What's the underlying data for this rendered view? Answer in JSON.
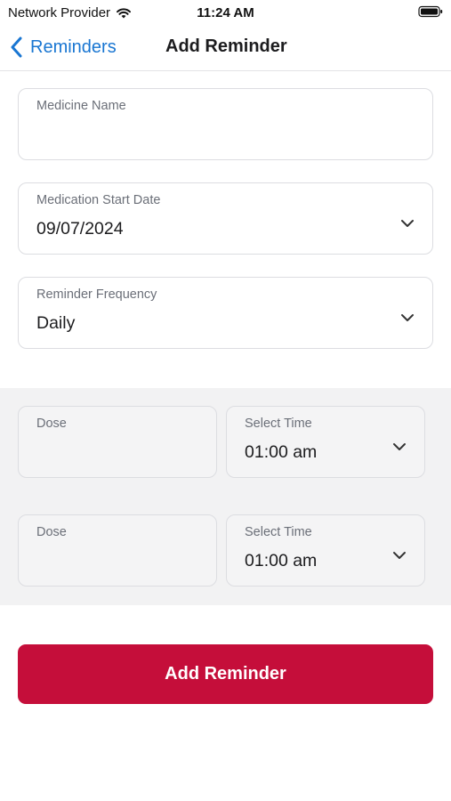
{
  "status_bar": {
    "carrier": "Network Provider",
    "time": "11:24 AM",
    "wifi_icon": "wifi-icon",
    "battery_icon": "battery-icon"
  },
  "nav": {
    "back_label": "Reminders",
    "back_icon": "chevron-left-icon",
    "title": "Add Reminder"
  },
  "form": {
    "medicine_name": {
      "label": "Medicine Name",
      "value": ""
    },
    "start_date": {
      "label": "Medication Start Date",
      "value": "09/07/2024"
    },
    "frequency": {
      "label": "Reminder Frequency",
      "value": "Daily"
    }
  },
  "doses": [
    {
      "dose_label": "Dose",
      "dose_value": "",
      "time_label": "Select Time",
      "time_value": "01:00 am"
    },
    {
      "dose_label": "Dose",
      "dose_value": "",
      "time_label": "Select Time",
      "time_value": "01:00 am"
    }
  ],
  "submit_label": "Add Reminder",
  "colors": {
    "accent": "#1976d2",
    "primary_button": "#c50e3a",
    "band_background": "#f2f2f3"
  }
}
